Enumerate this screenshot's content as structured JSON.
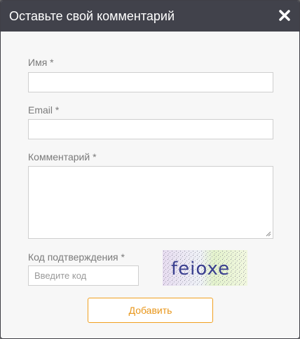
{
  "modal": {
    "title": "Оставьте свой комментарий",
    "close_icon": "close-icon"
  },
  "form": {
    "name_label": "Имя *",
    "email_label": "Email *",
    "comment_label": "Комментарий *",
    "code_label": "Код подтверждения *",
    "code_placeholder": "Введите код",
    "captcha_text": "feioxe",
    "submit_label": "Добавить"
  },
  "colors": {
    "header_bg": "#41424b",
    "accent": "#f0a020"
  }
}
